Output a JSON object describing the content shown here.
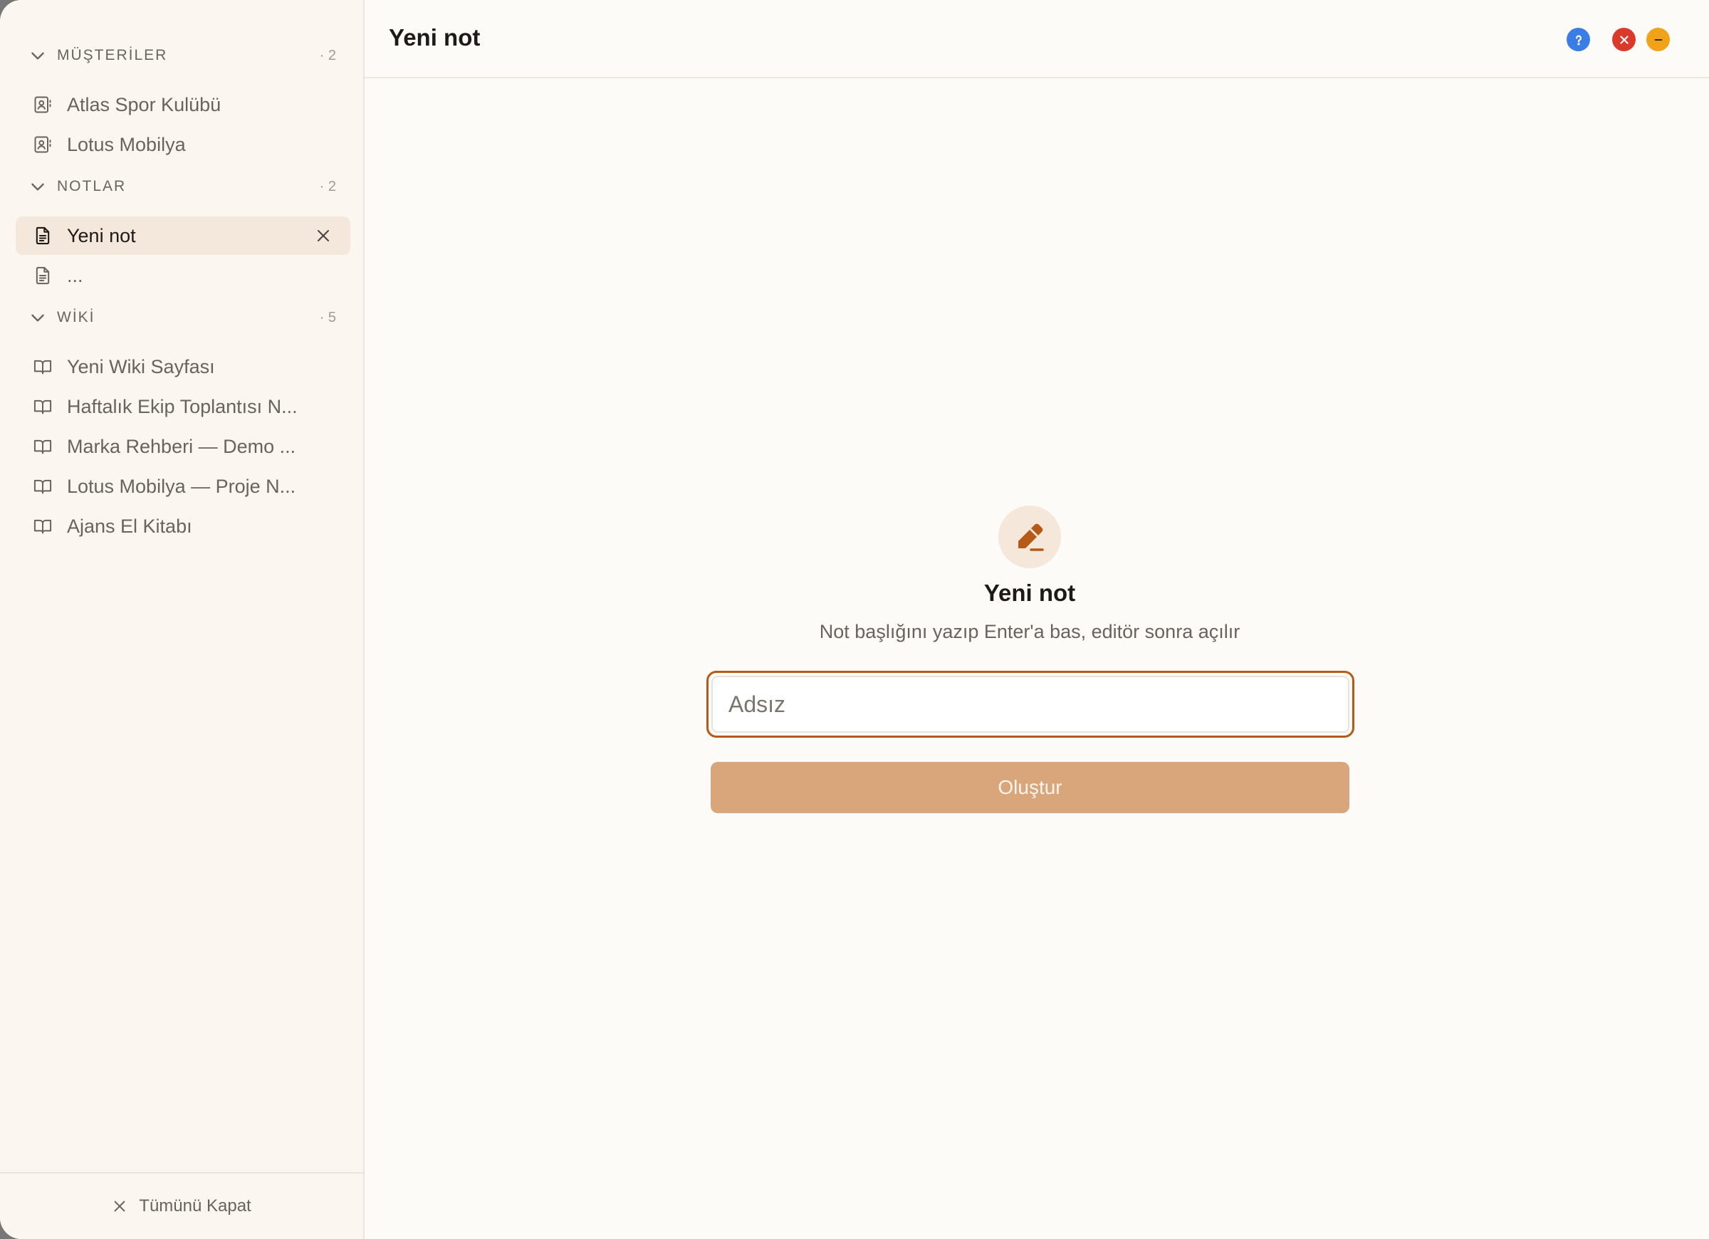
{
  "colors": {
    "accent": "#b65a17",
    "button_bg": "#d9a67c",
    "help": "#3b7de6",
    "close": "#d93a2b",
    "minimize": "#f0a21b"
  },
  "sidebar": {
    "sections": [
      {
        "label": "MÜŞTERİLER",
        "count": "· 2",
        "items": [
          {
            "label": "Atlas Spor Kulübü",
            "icon": "contact-card-icon"
          },
          {
            "label": "Lotus Mobilya",
            "icon": "contact-card-icon"
          }
        ]
      },
      {
        "label": "NOTLAR",
        "count": "· 2",
        "items": [
          {
            "label": "Yeni not",
            "icon": "document-icon",
            "active": true
          },
          {
            "label": "...",
            "icon": "document-icon"
          }
        ]
      },
      {
        "label": "WİKİ",
        "count": "· 5",
        "items": [
          {
            "label": "Yeni Wiki Sayfası",
            "icon": "book-icon"
          },
          {
            "label": "Haftalık Ekip Toplantısı N...",
            "icon": "book-icon"
          },
          {
            "label": "Marka Rehberi — Demo ...",
            "icon": "book-icon"
          },
          {
            "label": "Lotus Mobilya — Proje N...",
            "icon": "book-icon"
          },
          {
            "label": "Ajans El Kitabı",
            "icon": "book-icon"
          }
        ]
      }
    ],
    "footer_label": "Tümünü Kapat"
  },
  "topbar": {
    "title": "Yeni not"
  },
  "main": {
    "heading": "Yeni not",
    "subtitle": "Not başlığını yazıp Enter'a bas, editör sonra açılır",
    "input_placeholder": "Adsız",
    "input_value": "",
    "create_label": "Oluştur"
  }
}
